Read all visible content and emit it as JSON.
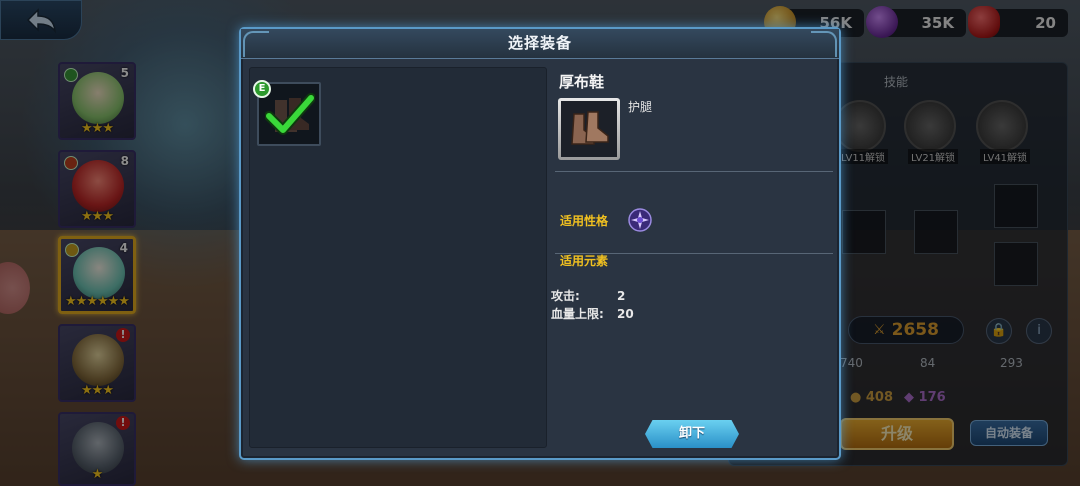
{
  "currencies": {
    "gold": "56K",
    "crystal": "35K",
    "gem": "20"
  },
  "heroes": [
    {
      "level": "5",
      "stars": "★★★"
    },
    {
      "level": "8",
      "stars": "★★★"
    },
    {
      "level": "4",
      "stars": "★★★★★★"
    },
    {
      "level": "",
      "stars": "★★★",
      "alert": "!"
    },
    {
      "level": "",
      "stars": "★",
      "alert": "!"
    }
  ],
  "right_panel": {
    "skills_title": "技能",
    "skill_locks": [
      "LV11解锁",
      "LV21解锁",
      "LV41解锁"
    ],
    "power": "2658",
    "stats": [
      "740",
      "84",
      "293"
    ],
    "resources": [
      "408",
      "176"
    ],
    "upgrade_label": "升级",
    "auto_equip_label": "自动装备"
  },
  "modal": {
    "title": "选择装备",
    "equipped_badge": "E",
    "item": {
      "name": "厚布鞋",
      "type": "护腿",
      "applicable_trait_label": "适用性格",
      "applicable_element_label": "适用元素",
      "stats": [
        {
          "label": "攻击:",
          "value": "2"
        },
        {
          "label": "血量上限:",
          "value": "20"
        }
      ]
    },
    "unequip_label": "卸下"
  },
  "colors": {
    "accent_gold": "#f0c020",
    "modal_border": "#5a9ac8",
    "button_blue": "#2a90c8"
  }
}
